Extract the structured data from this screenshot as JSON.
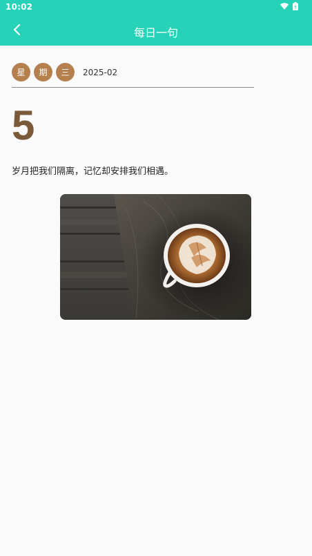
{
  "status": {
    "time": "10:02"
  },
  "header": {
    "title": "每日一句",
    "back_icon": "chevron-left-icon"
  },
  "date": {
    "weekday_chars": [
      "星",
      "期",
      "三"
    ],
    "year_month": "2025-02",
    "day": "5"
  },
  "quote": {
    "text": "岁月把我们隔离，记忆却安排我们相遇。"
  },
  "image": {
    "subject": "coffee-latte-art-on-wooden-table"
  },
  "colors": {
    "header_bg": "#26d3b8",
    "chip_bg": "#b5804d",
    "day_color": "#7b5a3a",
    "page_bg": "#fafafa"
  }
}
